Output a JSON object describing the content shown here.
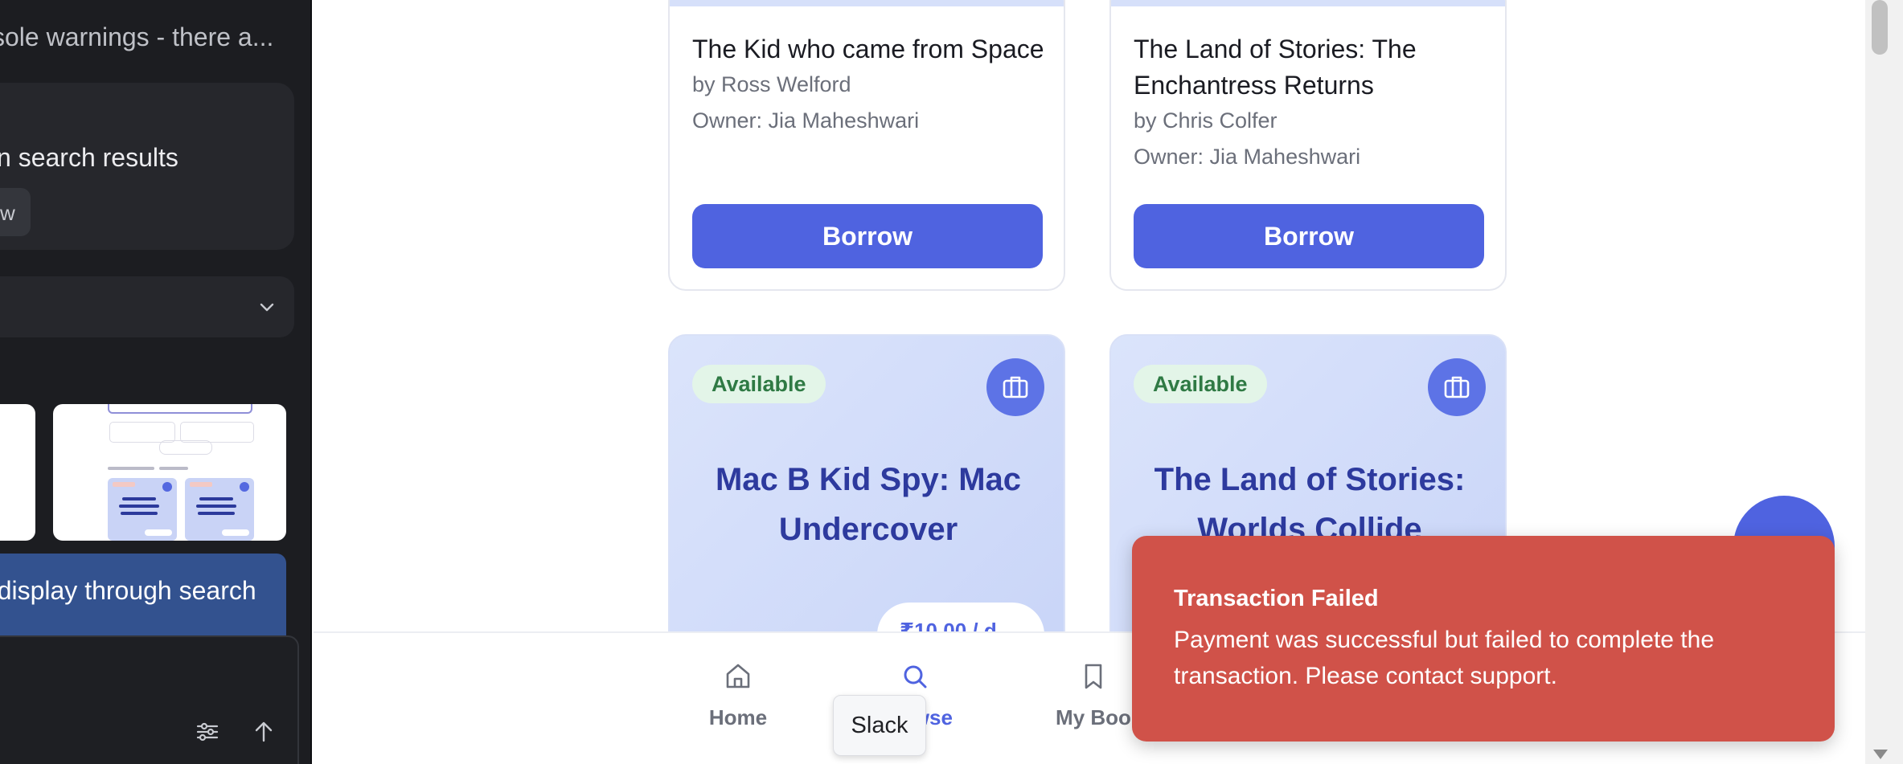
{
  "sidebar": {
    "header_text": "sole warnings - there a...",
    "card_text": "n search results",
    "chip_label": "w",
    "banner_text": "e display through search"
  },
  "books_top": [
    {
      "title": "The Kid who came from Space",
      "author": "by Ross Welford",
      "owner": "Owner: Jia Maheshwari",
      "button_label": "Borrow"
    },
    {
      "title": "The Land of Stories: The Enchantress Returns",
      "author": "by Chris Colfer",
      "owner": "Owner: Jia Maheshwari",
      "button_label": "Borrow"
    }
  ],
  "books_bottom": [
    {
      "status": "Available",
      "cover_title": "Mac B Kid Spy: Mac Undercover",
      "price": "₹10.00 / d"
    },
    {
      "status": "Available",
      "cover_title": "The Land of Stories: Worlds Collide"
    }
  ],
  "bottom_nav": {
    "items": [
      {
        "label": "Home",
        "icon": "home-icon"
      },
      {
        "label": "Browse",
        "icon": "search-icon",
        "active": true
      },
      {
        "label": "My Boo",
        "icon": "bookmark-icon"
      }
    ]
  },
  "toast": {
    "title": "Transaction Failed",
    "message": "Payment was successful but failed to complete the transaction. Please contact support."
  },
  "tooltip": {
    "text": "Slack"
  },
  "colors": {
    "accent": "#4f63e0",
    "toast_bg": "#d05249",
    "available_bg": "#e3f5e8",
    "available_text": "#2f7a44",
    "sidebar_bg": "#1c1d21"
  }
}
